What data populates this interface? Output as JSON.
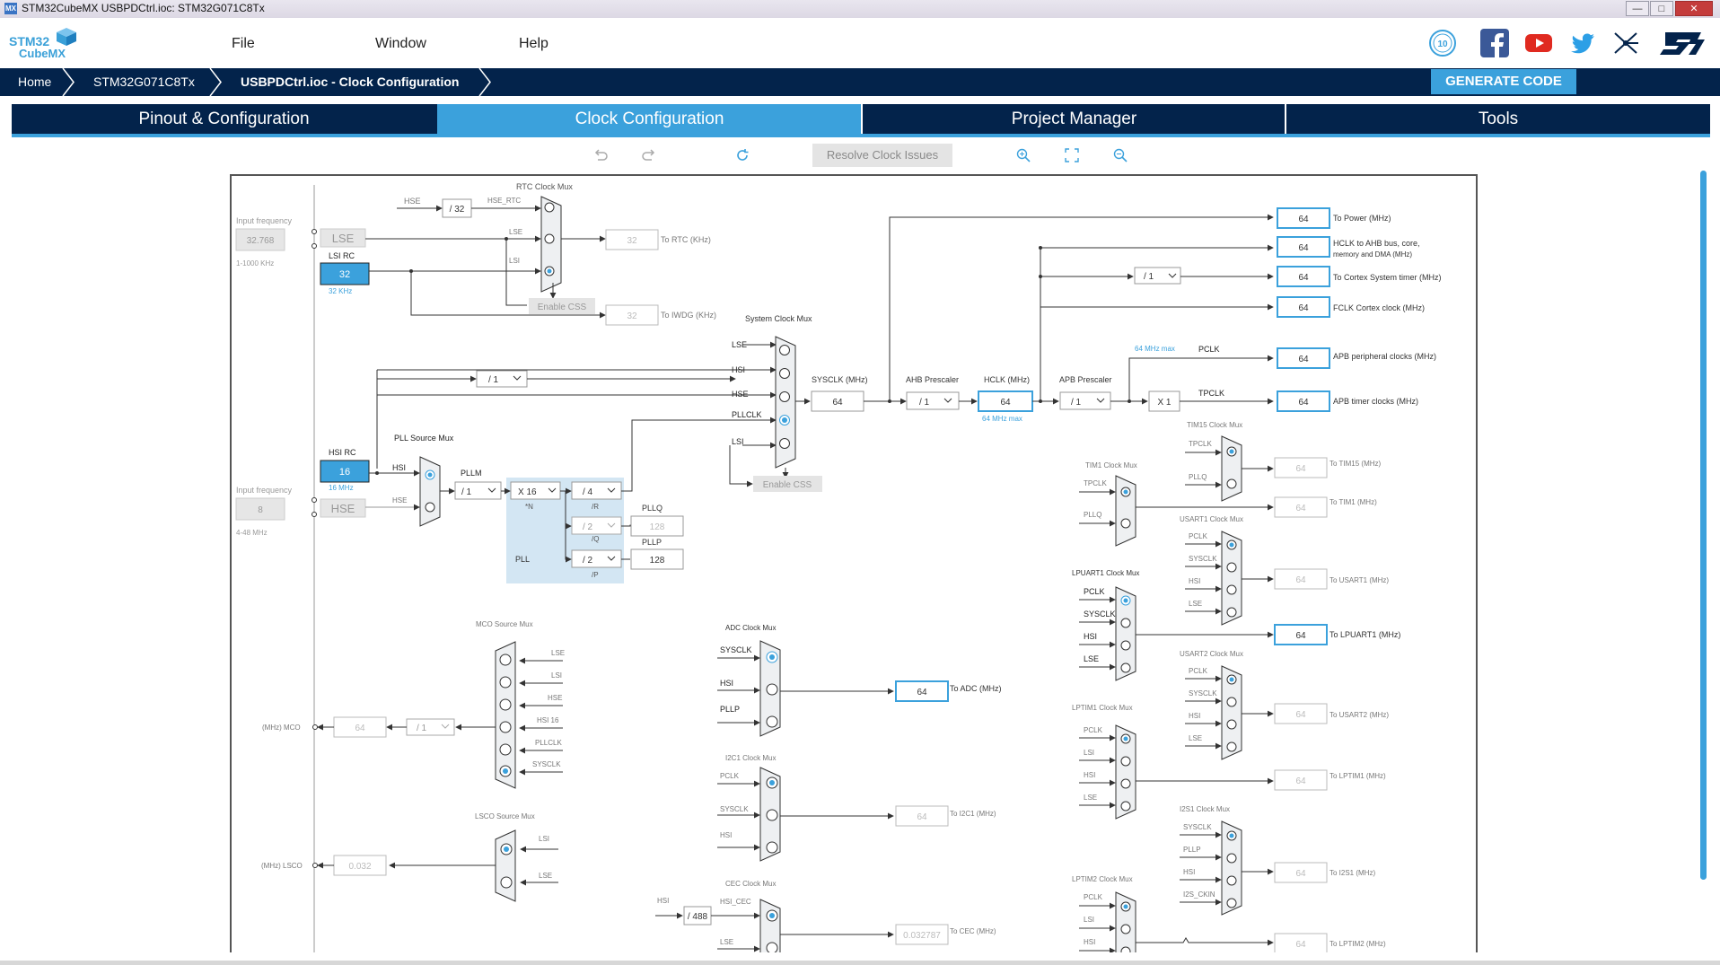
{
  "window": {
    "app_icon": "MX",
    "title": "STM32CubeMX USBPDCtrl.ioc: STM32G071C8Tx",
    "minimize": "—",
    "maximize": "□",
    "close": "✕"
  },
  "logo": {
    "line1": "STM32",
    "line2": "CubeMX"
  },
  "menu": [
    "File",
    "Window",
    "Help"
  ],
  "social_icons": [
    "anniversary-badge-icon",
    "facebook-icon",
    "youtube-icon",
    "twitter-icon",
    "network-icon",
    "st-logo-icon"
  ],
  "breadcrumb": [
    "Home",
    "STM32G071C8Tx",
    "USBPDCtrl.ioc - Clock Configuration"
  ],
  "generate_code": "GENERATE CODE",
  "tabs": [
    "Pinout & Configuration",
    "Clock Configuration",
    "Project Manager",
    "Tools"
  ],
  "active_tab": 1,
  "toolbar": {
    "undo": "undo-icon",
    "redo": "redo-icon",
    "reset": "refresh-icon",
    "resolve": "Resolve Clock Issues",
    "zoom_in": "zoom-in-icon",
    "fit": "fit-screen-icon",
    "zoom_out": "zoom-out-icon"
  },
  "colors": {
    "navy": "#03234b",
    "blue": "#3ba1dc",
    "wire": "#333333",
    "muted": "#a8a8a8"
  },
  "diagram": {
    "rtc_mux_title": "RTC Clock Mux",
    "input_freq_label": "Input frequency",
    "lse_input": "32.768",
    "lse_range": "1-1000 KHz",
    "lse_label": "LSE",
    "lsi_rc_label": "LSI RC",
    "lsi_value": "32",
    "lsi_khz": "32 KHz",
    "hse_rtc_src": "HSE",
    "hse_rtc_div": "/ 32",
    "hse_rtc_label": "HSE_RTC",
    "rtc_lse": "LSE",
    "rtc_lsi": "LSI",
    "rtc_out": "32",
    "rtc_out_label": "To RTC (KHz)",
    "enable_css_1": "Enable CSS",
    "iwdg_out": "32",
    "iwdg_label": "To IWDG (KHz)",
    "sysclk_mux_title": "System Clock Mux",
    "sys_lse": "LSE",
    "sys_hsi": "HSI",
    "sys_hse": "HSE",
    "sys_pllclk": "PLLCLK",
    "sys_lsi": "LSI",
    "enable_css_2": "Enable CSS",
    "hsi_div": "/ 1",
    "hsi_rc_label": "HSI RC",
    "hsi_value": "16",
    "hsi_mhz": "16 MHz",
    "hse_input_label": "Input frequency",
    "hse_value": "8",
    "hse_range": "4-48 MHz",
    "hse_label": "HSE",
    "pll_source_mux": "PLL Source Mux",
    "pll_hsi": "HSI",
    "pll_hse": "HSE",
    "pllm_label": "PLLM",
    "pllm_value": "/ 1",
    "plln_value": "X 16",
    "plln_label": "*N",
    "pllr_value": "/ 4",
    "pllr_label": "/R",
    "pllq_value": "/ 2",
    "pllq_label": "/Q",
    "pllp_value": "/ 2",
    "pllp_label": "/P",
    "pll_label": "PLL",
    "pllq_out_label": "PLLQ",
    "pllq_out": "128",
    "pllp_out_label": "PLLP",
    "pllp_out": "128",
    "sysclk_label": "SYSCLK (MHz)",
    "sysclk_value": "64",
    "ahb_label": "AHB Prescaler",
    "ahb_value": "/ 1",
    "hclk_label": "HCLK (MHz)",
    "hclk_value": "64",
    "hclk_max": "64 MHz max",
    "apb_label": "APB Prescaler",
    "apb_value": "/ 1",
    "apb_max": "64 MHz max",
    "pclk_label": "PCLK",
    "tpclk_label": "TPCLK",
    "x1_label": "X 1",
    "cortex_div": "/ 1",
    "outputs": [
      {
        "value": "64",
        "label": "To Power (MHz)"
      },
      {
        "value": "64",
        "label": "HCLK to AHB bus, core,",
        "label2": "memory and DMA (MHz)"
      },
      {
        "value": "64",
        "label": "To Cortex System timer (MHz)"
      },
      {
        "value": "64",
        "label": "FCLK Cortex clock (MHz)"
      },
      {
        "value": "64",
        "label": "APB peripheral clocks (MHz)"
      },
      {
        "value": "64",
        "label": "APB timer clocks (MHz)"
      }
    ],
    "tim15_mux": "TIM15 Clock Mux",
    "tim15_in": [
      "TPCLK",
      "PLLQ"
    ],
    "tim15_out": "64",
    "tim15_label": "To TIM15 (MHz)",
    "tim1_mux": "TIM1 Clock Mux",
    "tim1_in": [
      "TPCLK",
      "PLLQ"
    ],
    "tim1_out": "64",
    "tim1_label": "To TIM1 (MHz)",
    "usart1_mux": "USART1 Clock Mux",
    "usart1_in": [
      "PCLK",
      "SYSCLK",
      "HSI",
      "LSE"
    ],
    "usart1_out": "64",
    "usart1_label": "To USART1 (MHz)",
    "lpuart1_mux": "LPUART1 Clock Mux",
    "lpuart1_in": [
      "PCLK",
      "SYSCLK",
      "HSI",
      "LSE"
    ],
    "lpuart1_out": "64",
    "lpuart1_label": "To LPUART1 (MHz)",
    "usart2_mux": "USART2 Clock Mux",
    "usart2_in": [
      "PCLK",
      "SYSCLK",
      "HSI",
      "LSE"
    ],
    "usart2_out": "64",
    "usart2_label": "To USART2 (MHz)",
    "lptim1_mux": "LPTIM1 Clock Mux",
    "lptim1_in": [
      "PCLK",
      "LSI",
      "HSI",
      "LSE"
    ],
    "lptim1_out": "64",
    "lptim1_label": "To LPTIM1 (MHz)",
    "i2s1_mux": "I2S1 Clock Mux",
    "i2s1_in": [
      "SYSCLK",
      "PLLP",
      "HSI",
      "I2S_CKIN"
    ],
    "i2s1_out": "64",
    "i2s1_label": "To I2S1 (MHz)",
    "lptim2_mux": "LPTIM2 Clock Mux",
    "lptim2_in": [
      "PCLK",
      "LSI",
      "HSI"
    ],
    "lptim2_out": "64",
    "lptim2_label": "To LPTIM2 (MHz)",
    "adc_mux": "ADC Clock Mux",
    "adc_in": [
      "SYSCLK",
      "HSI",
      "PLLP"
    ],
    "adc_out": "64",
    "adc_label": "To ADC (MHz)",
    "i2c1_mux": "I2C1 Clock Mux",
    "i2c1_in": [
      "PCLK",
      "SYSCLK",
      "HSI"
    ],
    "i2c1_out": "64",
    "i2c1_label": "To I2C1 (MHz)",
    "cec_mux": "CEC Clock Mux",
    "cec_hsi": "HSI",
    "cec_div": "/ 488",
    "cec_in": [
      "HSI_CEC",
      "LSE"
    ],
    "cec_out": "0.032787",
    "cec_label": "To CEC (MHz)",
    "mco_mux": "MCO Source Mux",
    "mco_in": [
      "LSE",
      "LSI",
      "HSE",
      "HSI 16",
      "PLLCLK",
      "SYSCLK"
    ],
    "mco_label": "(MHz) MCO",
    "mco_out": "64",
    "mco_div": "/ 1",
    "lsco_mux": "LSCO Source Mux",
    "lsco_in": [
      "LSI",
      "LSE"
    ],
    "lsco_label": "(MHz) LSCO",
    "lsco_out": "0.032"
  }
}
